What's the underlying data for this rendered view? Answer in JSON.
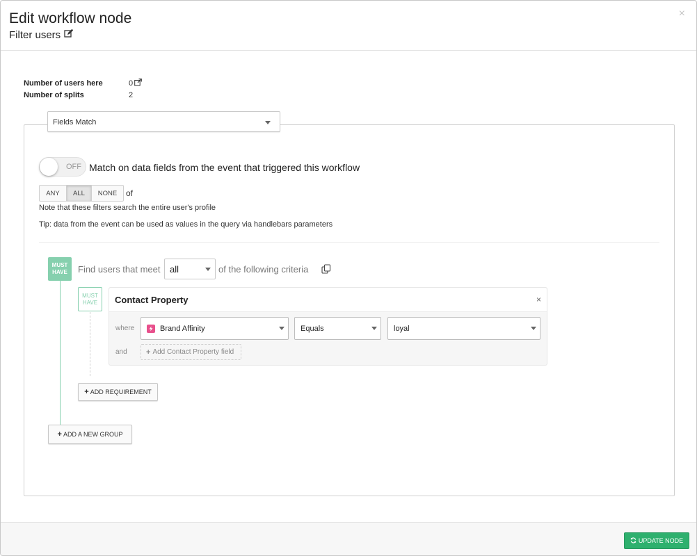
{
  "header": {
    "title": "Edit workflow node",
    "subtitle": "Filter users",
    "close_label": "×"
  },
  "stats": {
    "users_label": "Number of users here",
    "users_value": "0",
    "splits_label": "Number of splits",
    "splits_value": "2"
  },
  "filter_type": {
    "selected": "Fields Match"
  },
  "toggle": {
    "state_label": "OFF",
    "description": "Match on data fields from the event that triggered this workflow"
  },
  "match_mode": {
    "options": [
      "ANY",
      "ALL",
      "NONE"
    ],
    "selected": "ALL",
    "suffix": "of"
  },
  "notes": {
    "note": "Note that these filters search the entire user's profile",
    "tip": "Tip: data from the event can be used as values in the query via handlebars parameters"
  },
  "group": {
    "badge": "MUST HAVE",
    "find_prefix": "Find users that meet",
    "match_value": "all",
    "find_suffix": "of the following criteria"
  },
  "requirement": {
    "badge": "MUST HAVE",
    "title": "Contact Property",
    "where_label": "where",
    "and_label": "and",
    "property": "Brand Affinity",
    "operator": "Equals",
    "value": "loyal",
    "add_field_label": "Add Contact Property field"
  },
  "buttons": {
    "add_requirement": "ADD REQUIREMENT",
    "add_group": "ADD A NEW GROUP",
    "update_node": "UPDATE NODE"
  },
  "colors": {
    "accent_green": "#86d0ae",
    "button_green": "#2eb06e",
    "property_icon": "#e8508c"
  }
}
